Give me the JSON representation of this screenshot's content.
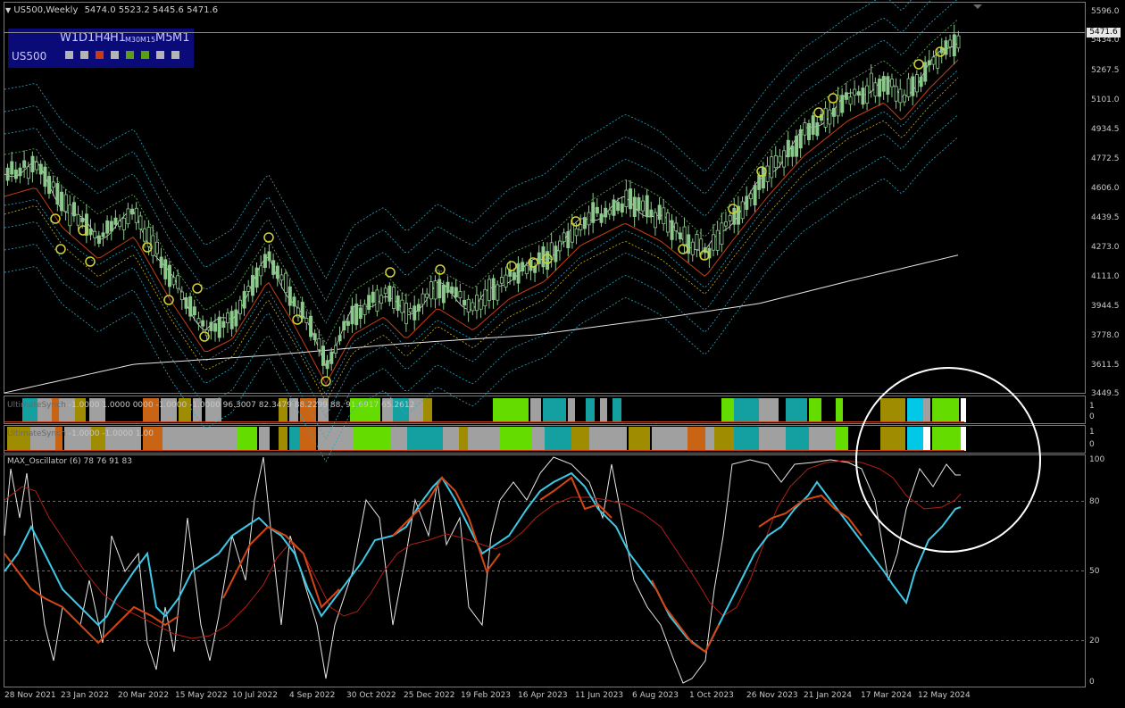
{
  "header": {
    "symbol_period": "US500,Weekly",
    "ohlc": "5474.0 5523.2 5445.6 5471.6"
  },
  "tf_panel": {
    "symbol": "US500",
    "timeframes": [
      "W1",
      "D1",
      "H4",
      "H1",
      "M30",
      "M15",
      "M5",
      "M1"
    ],
    "squares": [
      "#b4b4b4",
      "#b4b4b4",
      "#c83c14",
      "#b4b4b4",
      "#5aa014",
      "#5aa014",
      "#b4b4b4",
      "#b4b4b4"
    ]
  },
  "price_axis": {
    "ticks": [
      "5596.0",
      "5434.0",
      "5267.5",
      "5101.0",
      "4934.5",
      "4772.5",
      "4606.0",
      "4439.5",
      "4273.0",
      "4111.0",
      "3944.5",
      "3778.0",
      "3611.5",
      "3449.5"
    ],
    "current": "5471.6"
  },
  "date_axis": [
    "28 Nov 2021",
    "23 Jan 2022",
    "20 Mar 2022",
    "15 May 2022",
    "10 Jul 2022",
    "4 Sep 2022",
    "30 Oct 2022",
    "25 Dec 2022",
    "19 Feb 2023",
    "16 Apr 2023",
    "11 Jun 2023",
    "6 Aug 2023",
    "1 Oct 2023",
    "26 Nov 2023",
    "21 Jan 2024",
    "17 Mar 2024",
    "12 May 2024"
  ],
  "indicator1": {
    "title_a": "UltimateSynch",
    "title_b": " -1.0000 1.0000 ",
    "values": "0000 -1.0000 -1.0000 96.3007 82.3479 88.2299 88.",
    "tail": " 91.6917 65.2612",
    "scale": [
      "1",
      "0"
    ]
  },
  "indicator2": {
    "title_a": "UltimateSynch",
    "values": " -1.0000 -1.0000 1.00",
    "scale": [
      "1",
      "0"
    ]
  },
  "oscillator": {
    "title": "MAX_Oscillator (6) 78 76 91 83",
    "levels": [
      "100",
      "80",
      "50",
      "20",
      "0"
    ]
  },
  "colors": {
    "bull_candle": "#8cc88c",
    "bear_candle": "#8cc88c",
    "band": "#29a8c0",
    "ma_white": "#e6e6e6",
    "ma_red": "#c83c14",
    "ma_yellow": "#c8b41e",
    "highlight_circle": "#d2d232",
    "osc_white": "#e6e6e6",
    "osc_red": "#d24614",
    "osc_cyan": "#3cc8e6",
    "osc_signal": "#b41e14",
    "cyan": "#00c8e6",
    "lime": "#64dc00",
    "olive": "#a08c00",
    "teal": "#14a0a0",
    "orange": "#c86414",
    "gray": "#a0a0a0"
  },
  "icons": [
    "dropdown-triangle-icon"
  ]
}
